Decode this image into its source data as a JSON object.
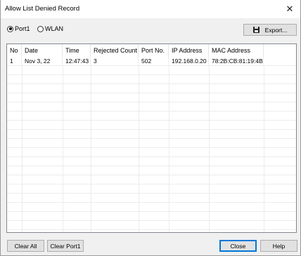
{
  "window": {
    "title": "Allow List Denied Record",
    "close_glyph": "✕"
  },
  "radios": {
    "port1": {
      "label": "Port1",
      "selected": true
    },
    "wlan": {
      "label": "WLAN",
      "selected": false
    }
  },
  "toolbar": {
    "export_label": "Export...",
    "export_icon": "floppy-disk-icon"
  },
  "table": {
    "columns": [
      "No",
      "Date",
      "Time",
      "Rejected Count",
      "Port No.",
      "IP Address",
      "MAC Address"
    ],
    "rows": [
      [
        "1",
        "Nov 3, 22",
        "12:47:43",
        "3",
        "502",
        "192.168.0.20",
        "78:2B:CB:81:19:4B"
      ]
    ]
  },
  "footer": {
    "clear_all_label": "Clear All",
    "clear_port1_label": "Clear Port1",
    "close_label": "Close",
    "help_label": "Help"
  },
  "colors": {
    "accent": "#0078d7",
    "dialog_bg": "#f0f0f0",
    "list_bg": "#ffffff"
  }
}
